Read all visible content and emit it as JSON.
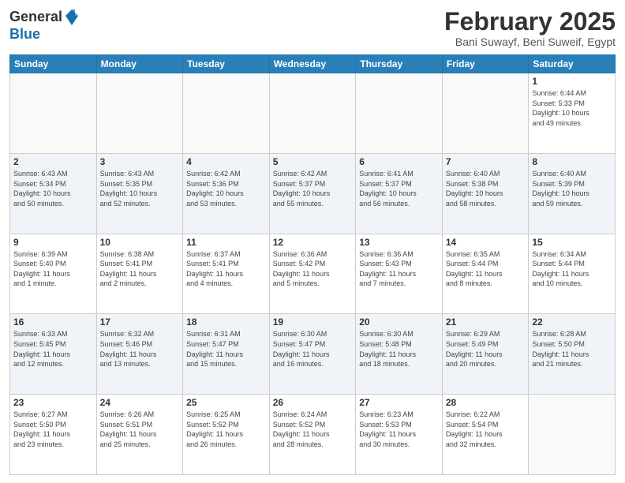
{
  "header": {
    "logo_general": "General",
    "logo_blue": "Blue",
    "title": "February 2025",
    "subtitle": "Bani Suwayf, Beni Suweif, Egypt"
  },
  "weekdays": [
    "Sunday",
    "Monday",
    "Tuesday",
    "Wednesday",
    "Thursday",
    "Friday",
    "Saturday"
  ],
  "weeks": [
    [
      {
        "day": "",
        "info": ""
      },
      {
        "day": "",
        "info": ""
      },
      {
        "day": "",
        "info": ""
      },
      {
        "day": "",
        "info": ""
      },
      {
        "day": "",
        "info": ""
      },
      {
        "day": "",
        "info": ""
      },
      {
        "day": "1",
        "info": "Sunrise: 6:44 AM\nSunset: 5:33 PM\nDaylight: 10 hours\nand 49 minutes."
      }
    ],
    [
      {
        "day": "2",
        "info": "Sunrise: 6:43 AM\nSunset: 5:34 PM\nDaylight: 10 hours\nand 50 minutes."
      },
      {
        "day": "3",
        "info": "Sunrise: 6:43 AM\nSunset: 5:35 PM\nDaylight: 10 hours\nand 52 minutes."
      },
      {
        "day": "4",
        "info": "Sunrise: 6:42 AM\nSunset: 5:36 PM\nDaylight: 10 hours\nand 53 minutes."
      },
      {
        "day": "5",
        "info": "Sunrise: 6:42 AM\nSunset: 5:37 PM\nDaylight: 10 hours\nand 55 minutes."
      },
      {
        "day": "6",
        "info": "Sunrise: 6:41 AM\nSunset: 5:37 PM\nDaylight: 10 hours\nand 56 minutes."
      },
      {
        "day": "7",
        "info": "Sunrise: 6:40 AM\nSunset: 5:38 PM\nDaylight: 10 hours\nand 58 minutes."
      },
      {
        "day": "8",
        "info": "Sunrise: 6:40 AM\nSunset: 5:39 PM\nDaylight: 10 hours\nand 59 minutes."
      }
    ],
    [
      {
        "day": "9",
        "info": "Sunrise: 6:39 AM\nSunset: 5:40 PM\nDaylight: 11 hours\nand 1 minute."
      },
      {
        "day": "10",
        "info": "Sunrise: 6:38 AM\nSunset: 5:41 PM\nDaylight: 11 hours\nand 2 minutes."
      },
      {
        "day": "11",
        "info": "Sunrise: 6:37 AM\nSunset: 5:41 PM\nDaylight: 11 hours\nand 4 minutes."
      },
      {
        "day": "12",
        "info": "Sunrise: 6:36 AM\nSunset: 5:42 PM\nDaylight: 11 hours\nand 5 minutes."
      },
      {
        "day": "13",
        "info": "Sunrise: 6:36 AM\nSunset: 5:43 PM\nDaylight: 11 hours\nand 7 minutes."
      },
      {
        "day": "14",
        "info": "Sunrise: 6:35 AM\nSunset: 5:44 PM\nDaylight: 11 hours\nand 8 minutes."
      },
      {
        "day": "15",
        "info": "Sunrise: 6:34 AM\nSunset: 5:44 PM\nDaylight: 11 hours\nand 10 minutes."
      }
    ],
    [
      {
        "day": "16",
        "info": "Sunrise: 6:33 AM\nSunset: 5:45 PM\nDaylight: 11 hours\nand 12 minutes."
      },
      {
        "day": "17",
        "info": "Sunrise: 6:32 AM\nSunset: 5:46 PM\nDaylight: 11 hours\nand 13 minutes."
      },
      {
        "day": "18",
        "info": "Sunrise: 6:31 AM\nSunset: 5:47 PM\nDaylight: 11 hours\nand 15 minutes."
      },
      {
        "day": "19",
        "info": "Sunrise: 6:30 AM\nSunset: 5:47 PM\nDaylight: 11 hours\nand 16 minutes."
      },
      {
        "day": "20",
        "info": "Sunrise: 6:30 AM\nSunset: 5:48 PM\nDaylight: 11 hours\nand 18 minutes."
      },
      {
        "day": "21",
        "info": "Sunrise: 6:29 AM\nSunset: 5:49 PM\nDaylight: 11 hours\nand 20 minutes."
      },
      {
        "day": "22",
        "info": "Sunrise: 6:28 AM\nSunset: 5:50 PM\nDaylight: 11 hours\nand 21 minutes."
      }
    ],
    [
      {
        "day": "23",
        "info": "Sunrise: 6:27 AM\nSunset: 5:50 PM\nDaylight: 11 hours\nand 23 minutes."
      },
      {
        "day": "24",
        "info": "Sunrise: 6:26 AM\nSunset: 5:51 PM\nDaylight: 11 hours\nand 25 minutes."
      },
      {
        "day": "25",
        "info": "Sunrise: 6:25 AM\nSunset: 5:52 PM\nDaylight: 11 hours\nand 26 minutes."
      },
      {
        "day": "26",
        "info": "Sunrise: 6:24 AM\nSunset: 5:52 PM\nDaylight: 11 hours\nand 28 minutes."
      },
      {
        "day": "27",
        "info": "Sunrise: 6:23 AM\nSunset: 5:53 PM\nDaylight: 11 hours\nand 30 minutes."
      },
      {
        "day": "28",
        "info": "Sunrise: 6:22 AM\nSunset: 5:54 PM\nDaylight: 11 hours\nand 32 minutes."
      },
      {
        "day": "",
        "info": ""
      }
    ]
  ]
}
